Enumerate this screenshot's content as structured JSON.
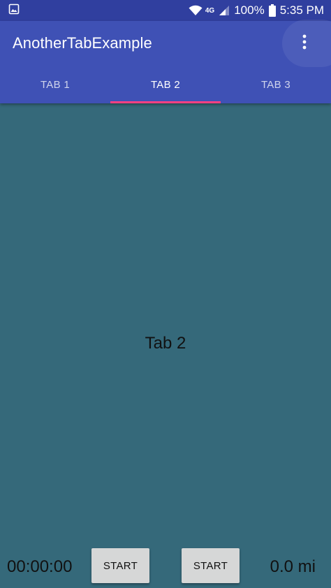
{
  "status_bar": {
    "battery": "100%",
    "time": "5:35 PM",
    "network": "4G",
    "icons": [
      "gallery-notification-icon",
      "wifi-icon",
      "signal-icon",
      "battery-icon"
    ]
  },
  "app_bar": {
    "title": "AnotherTabExample",
    "overflow_icon": "more-vert-icon"
  },
  "tabs": [
    {
      "label": "TAB 1",
      "selected": false
    },
    {
      "label": "TAB 2",
      "selected": true
    },
    {
      "label": "TAB 3",
      "selected": false
    }
  ],
  "content": {
    "label": "Tab 2"
  },
  "bottom": {
    "timer": "00:00:00",
    "start_label_1": "START",
    "start_label_2": "START",
    "distance": "0.0 mi"
  },
  "colors": {
    "status_bar": "#303f9f",
    "primary": "#3f51b5",
    "accent": "#ff4081",
    "content_bg": "#35697a",
    "button_bg": "#d6d7d7"
  }
}
